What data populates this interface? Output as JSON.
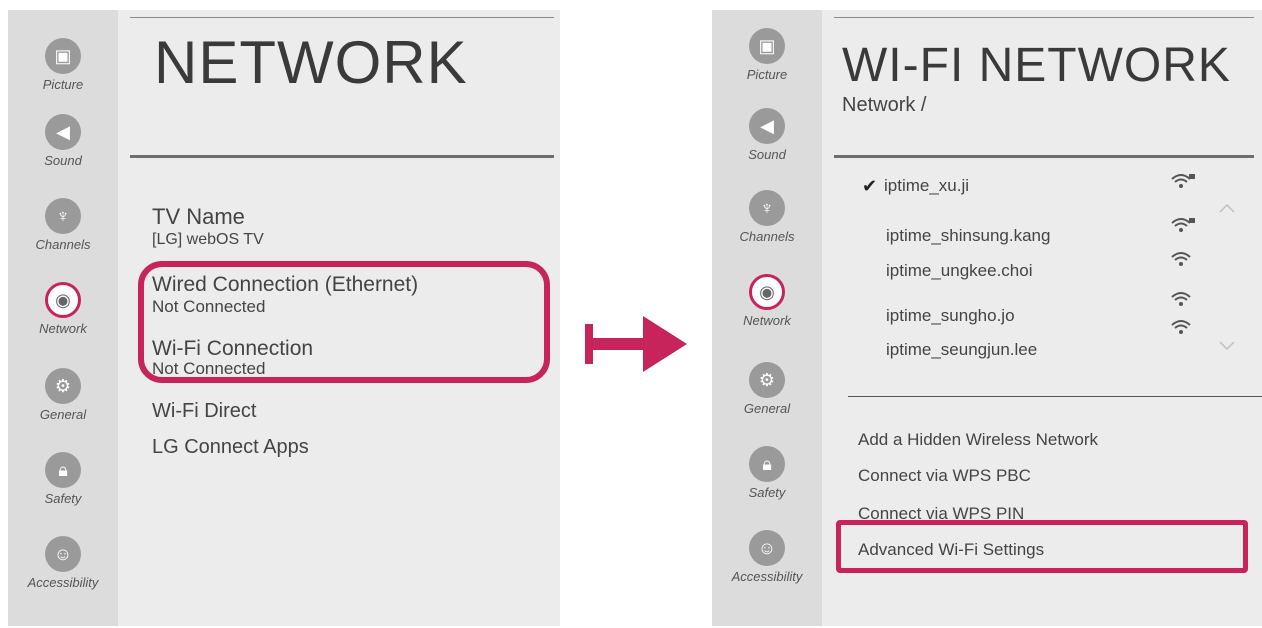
{
  "sidebar": {
    "items": [
      {
        "label": "Picture",
        "icon": "picture-icon"
      },
      {
        "label": "Sound",
        "icon": "sound-icon"
      },
      {
        "label": "Channels",
        "icon": "channels-icon"
      },
      {
        "label": "Network",
        "icon": "network-icon"
      },
      {
        "label": "General",
        "icon": "general-icon"
      },
      {
        "label": "Safety",
        "icon": "lock-icon"
      },
      {
        "label": "Accessibility",
        "icon": "accessibility-icon"
      }
    ]
  },
  "left": {
    "title": "NETWORK",
    "tv_name_label": "TV Name",
    "tv_name_value": "[LG] webOS TV",
    "wired_label": "Wired Connection (Ethernet)",
    "wired_status": "Not Connected",
    "wifi_label": "Wi-Fi Connection",
    "wifi_status": "Not Connected",
    "wifi_direct": "Wi-Fi Direct",
    "lg_connect": "LG Connect Apps"
  },
  "right": {
    "title": "WI-FI NETWORK",
    "breadcrumb": "Network /",
    "networks": [
      {
        "name": "iptime_xu.ji",
        "connected": true,
        "locked": true
      },
      {
        "name": "iptime_shinsung.kang",
        "connected": false,
        "locked": true
      },
      {
        "name": "iptime_ungkee.choi",
        "connected": false,
        "locked": false
      },
      {
        "name": "iptime_sungho.jo",
        "connected": false,
        "locked": false
      },
      {
        "name": "iptime_seungjun.lee",
        "connected": false,
        "locked": false
      }
    ],
    "checkmark": "✔",
    "actions": {
      "hidden": "Add a Hidden Wireless Network",
      "wps_pbc": "Connect via WPS PBC",
      "wps_pin": "Connect via WPS PIN",
      "advanced": "Advanced Wi-Fi Settings"
    }
  },
  "colors": {
    "accent": "#c8245c",
    "panel": "#ececec",
    "sidebar": "#dcdcdc"
  }
}
